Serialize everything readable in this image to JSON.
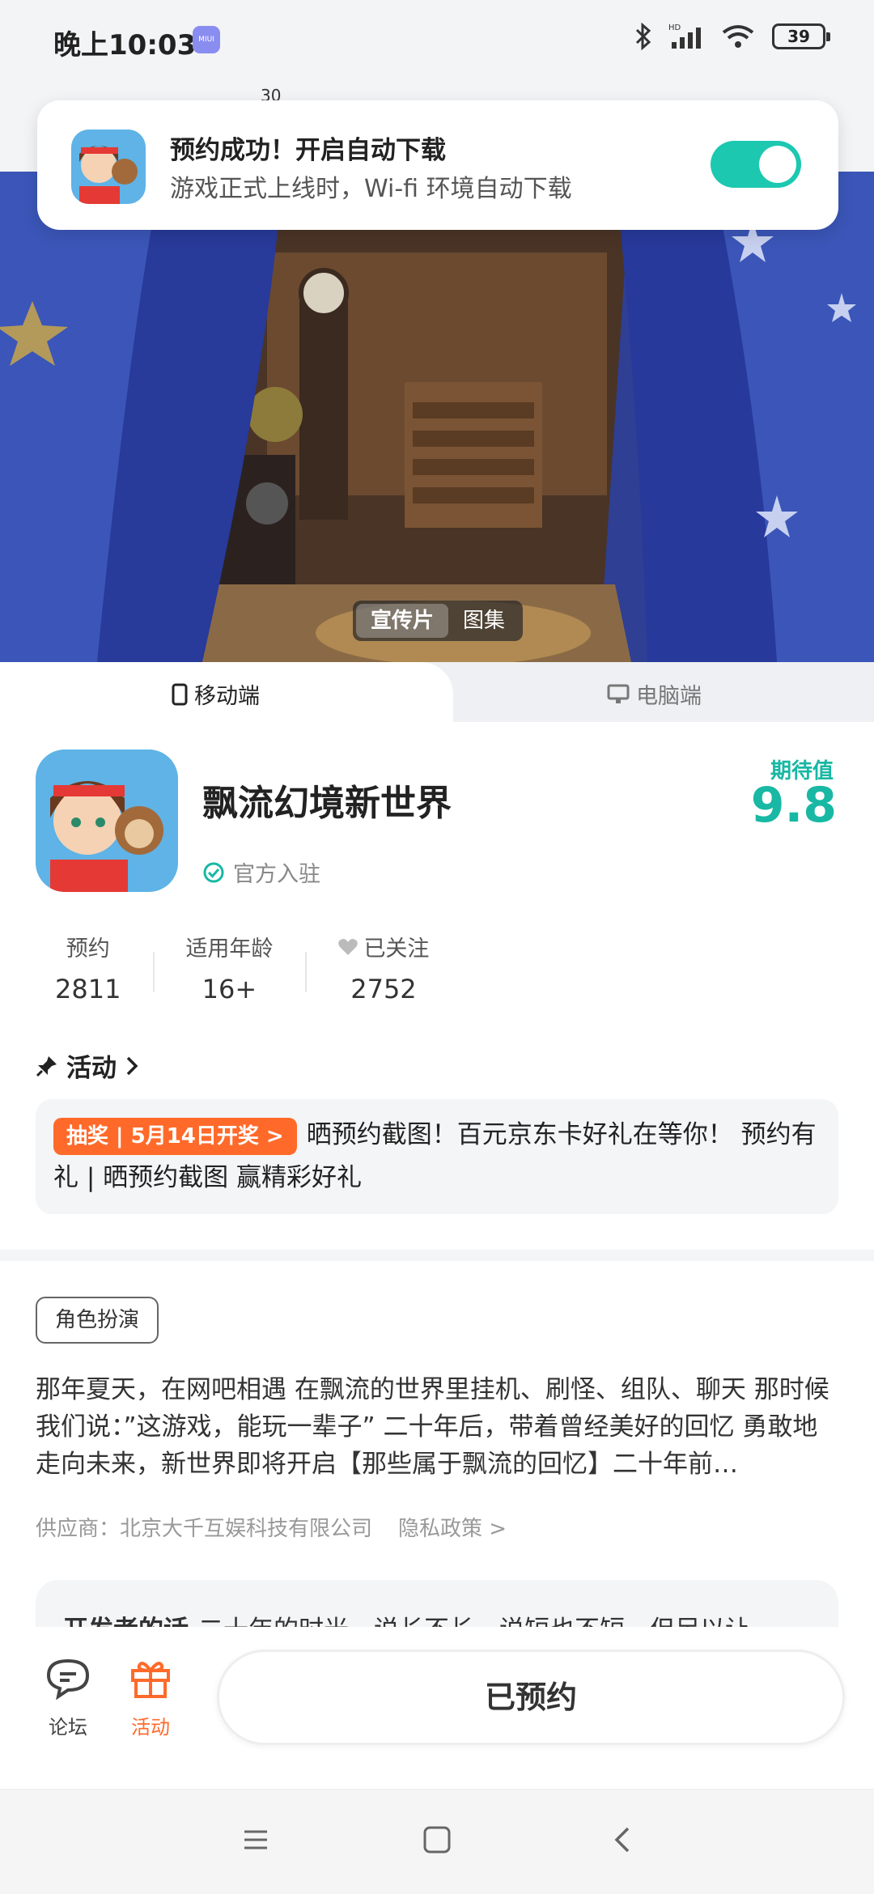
{
  "status_bar": {
    "time": "晚上10:03",
    "miui_label": "MIUI",
    "battery": "39",
    "hd_label": "HD"
  },
  "header": {
    "tiny_number": "30"
  },
  "notification": {
    "title": "预约成功！开启自动下载",
    "subtitle": "游戏正式上线时，Wi-fi 环境自动下载",
    "toggle_on": true
  },
  "hero": {
    "tabs": [
      "宣传片",
      "图集"
    ],
    "active_tab": "宣传片"
  },
  "platform_tabs": {
    "mobile": "移动端",
    "pc": "电脑端"
  },
  "app": {
    "name": "飘流幻境新世界",
    "official_label": "官方入驻",
    "expectation_label": "期待值",
    "expectation_value": "9.8",
    "stats": [
      {
        "label": "预约",
        "value": "2811"
      },
      {
        "label": "适用年龄",
        "value": "16+"
      },
      {
        "label": "已关注",
        "value": "2752"
      }
    ]
  },
  "activity": {
    "heading": "活动",
    "badge": "抽奖 | 5月14日开奖 >",
    "text": "晒预约截图！百元京东卡好礼在等你！ 预约有礼 | 晒预约截图 赢精彩好礼"
  },
  "details": {
    "genre": "角色扮演",
    "description": "那年夏天，在网吧相遇 在飘流的世界里挂机、刷怪、组队、聊天 那时候我们说：”这游戏，能玩一辈子” 二十年后，带着曾经美好的回忆 勇敢地走向未来，新世界即将开启【那些属于飘流的回忆】二十年前…",
    "supplier": "供应商：北京大千互娱科技有限公司",
    "privacy": "隐私政策 >",
    "dev_title": "开发者的话",
    "dev_text": "二十年的时光，说长不长，说短也不短，但足以让一"
  },
  "action_bar": {
    "forum": "论坛",
    "activity": "活动",
    "booked": "已预约"
  },
  "colors": {
    "accent": "#18b8a4",
    "orange": "#ff6a2a"
  }
}
